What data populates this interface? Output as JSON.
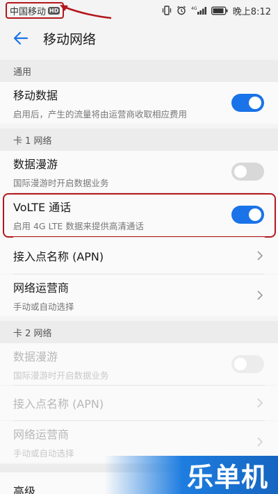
{
  "status_bar": {
    "carrier": "中国移动",
    "hd_badge": "HD",
    "time": "晚上8:12",
    "icons": [
      "vibrate-icon",
      "alarm-icon",
      "signal-4g-icon",
      "battery-icon"
    ]
  },
  "header": {
    "title": "移动网络",
    "back_icon": "back-arrow-icon"
  },
  "sections": {
    "general": {
      "title": "通用"
    },
    "card1": {
      "title": "卡 1 网络"
    },
    "card2": {
      "title": "卡 2 网络"
    }
  },
  "mobile_data": {
    "label": "移动数据",
    "sub": "启用后，产生的流量将由运营商收取相应费用",
    "enabled": true
  },
  "card1_roaming": {
    "label": "数据漫游",
    "sub": "国际漫游时开启数据业务",
    "enabled": false
  },
  "volte": {
    "label": "VoLTE 通话",
    "sub": "启用 4G LTE 数据来提供高清通话",
    "enabled": true
  },
  "card1_apn": {
    "label": "接入点名称 (APN)"
  },
  "card1_operator": {
    "label": "网络运营商",
    "sub": "手动或自动选择"
  },
  "card2_roaming": {
    "label": "数据漫游",
    "sub": "国际漫游时开启数据业务",
    "enabled": false
  },
  "card2_apn": {
    "label": "接入点名称 (APN)"
  },
  "card2_operator": {
    "label": "网络运营商",
    "sub": "手动或自动选择"
  },
  "advanced": {
    "label": "高级"
  },
  "watermark": {
    "text": "乐单机"
  },
  "colors": {
    "accent": "#1a73e8",
    "highlight": "#b3171d"
  }
}
